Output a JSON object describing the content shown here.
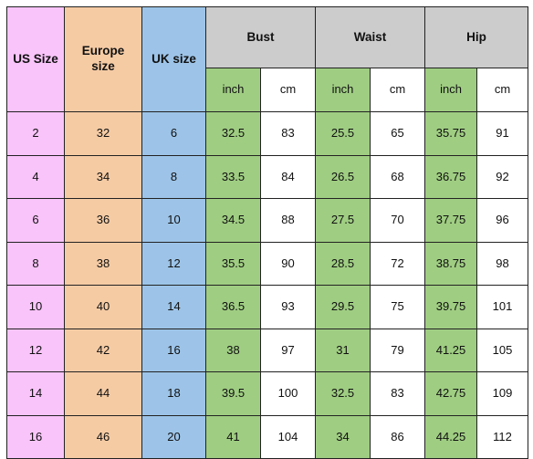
{
  "chart_data": {
    "type": "table",
    "title": "",
    "grid": true,
    "columns": [
      {
        "key": "us_size",
        "label": "US Size",
        "group": "",
        "unit": "",
        "color": "#f9c4f9"
      },
      {
        "key": "eu_size",
        "label": "Europe size",
        "group": "",
        "unit": "",
        "color": "#f5cba4"
      },
      {
        "key": "uk_size",
        "label": "UK size",
        "group": "",
        "unit": "",
        "color": "#9dc4e8"
      },
      {
        "key": "bust_in",
        "label": "inch",
        "group": "Bust",
        "unit": "inch",
        "color": "#9fcd82"
      },
      {
        "key": "bust_cm",
        "label": "cm",
        "group": "Bust",
        "unit": "cm",
        "color": "#ffffff"
      },
      {
        "key": "waist_in",
        "label": "inch",
        "group": "Waist",
        "unit": "inch",
        "color": "#9fcd82"
      },
      {
        "key": "waist_cm",
        "label": "cm",
        "group": "Waist",
        "unit": "cm",
        "color": "#ffffff"
      },
      {
        "key": "hip_in",
        "label": "inch",
        "group": "Hip",
        "unit": "inch",
        "color": "#9fcd82"
      },
      {
        "key": "hip_cm",
        "label": "cm",
        "group": "Hip",
        "unit": "cm",
        "color": "#ffffff"
      }
    ],
    "rows": [
      [
        "2",
        "32",
        "6",
        "32.5",
        "83",
        "25.5",
        "65",
        "35.75",
        "91"
      ],
      [
        "4",
        "34",
        "8",
        "33.5",
        "84",
        "26.5",
        "68",
        "36.75",
        "92"
      ],
      [
        "6",
        "36",
        "10",
        "34.5",
        "88",
        "27.5",
        "70",
        "37.75",
        "96"
      ],
      [
        "8",
        "38",
        "12",
        "35.5",
        "90",
        "28.5",
        "72",
        "38.75",
        "98"
      ],
      [
        "10",
        "40",
        "14",
        "36.5",
        "93",
        "29.5",
        "75",
        "39.75",
        "101"
      ],
      [
        "12",
        "42",
        "16",
        "38",
        "97",
        "31",
        "79",
        "41.25",
        "105"
      ],
      [
        "14",
        "44",
        "18",
        "39.5",
        "100",
        "32.5",
        "83",
        "42.75",
        "109"
      ],
      [
        "16",
        "46",
        "20",
        "41",
        "104",
        "34",
        "86",
        "44.25",
        "112"
      ]
    ]
  },
  "header": {
    "us_size": "US Size",
    "europe_size_line1": "Europe",
    "europe_size_line2": "size",
    "uk_size": "UK size",
    "bust": "Bust",
    "waist": "Waist",
    "hip": "Hip"
  },
  "units": {
    "bust_inch": "inch",
    "bust_cm": "cm",
    "waist_inch": "inch",
    "waist_cm": "cm",
    "hip_inch": "inch",
    "hip_cm": "cm"
  },
  "colors": {
    "us_size": "#f9c4f9",
    "europe_size": "#f5cba4",
    "uk_size": "#9dc4e8",
    "group_header": "#cccccc",
    "inch_cell": "#9fcd82",
    "cm_cell": "#ffffff",
    "border": "#222222",
    "text": "#111111"
  },
  "rows": [
    {
      "us": "2",
      "eu": "32",
      "uk": "6",
      "bust_in": "32.5",
      "bust_cm": "83",
      "waist_in": "25.5",
      "waist_cm": "65",
      "hip_in": "35.75",
      "hip_cm": "91"
    },
    {
      "us": "4",
      "eu": "34",
      "uk": "8",
      "bust_in": "33.5",
      "bust_cm": "84",
      "waist_in": "26.5",
      "waist_cm": "68",
      "hip_in": "36.75",
      "hip_cm": "92"
    },
    {
      "us": "6",
      "eu": "36",
      "uk": "10",
      "bust_in": "34.5",
      "bust_cm": "88",
      "waist_in": "27.5",
      "waist_cm": "70",
      "hip_in": "37.75",
      "hip_cm": "96"
    },
    {
      "us": "8",
      "eu": "38",
      "uk": "12",
      "bust_in": "35.5",
      "bust_cm": "90",
      "waist_in": "28.5",
      "waist_cm": "72",
      "hip_in": "38.75",
      "hip_cm": "98"
    },
    {
      "us": "10",
      "eu": "40",
      "uk": "14",
      "bust_in": "36.5",
      "bust_cm": "93",
      "waist_in": "29.5",
      "waist_cm": "75",
      "hip_in": "39.75",
      "hip_cm": "101"
    },
    {
      "us": "12",
      "eu": "42",
      "uk": "16",
      "bust_in": "38",
      "bust_cm": "97",
      "waist_in": "31",
      "waist_cm": "79",
      "hip_in": "41.25",
      "hip_cm": "105"
    },
    {
      "us": "14",
      "eu": "44",
      "uk": "18",
      "bust_in": "39.5",
      "bust_cm": "100",
      "waist_in": "32.5",
      "waist_cm": "83",
      "hip_in": "42.75",
      "hip_cm": "109"
    },
    {
      "us": "16",
      "eu": "46",
      "uk": "20",
      "bust_in": "41",
      "bust_cm": "104",
      "waist_in": "34",
      "waist_cm": "86",
      "hip_in": "44.25",
      "hip_cm": "112"
    }
  ]
}
